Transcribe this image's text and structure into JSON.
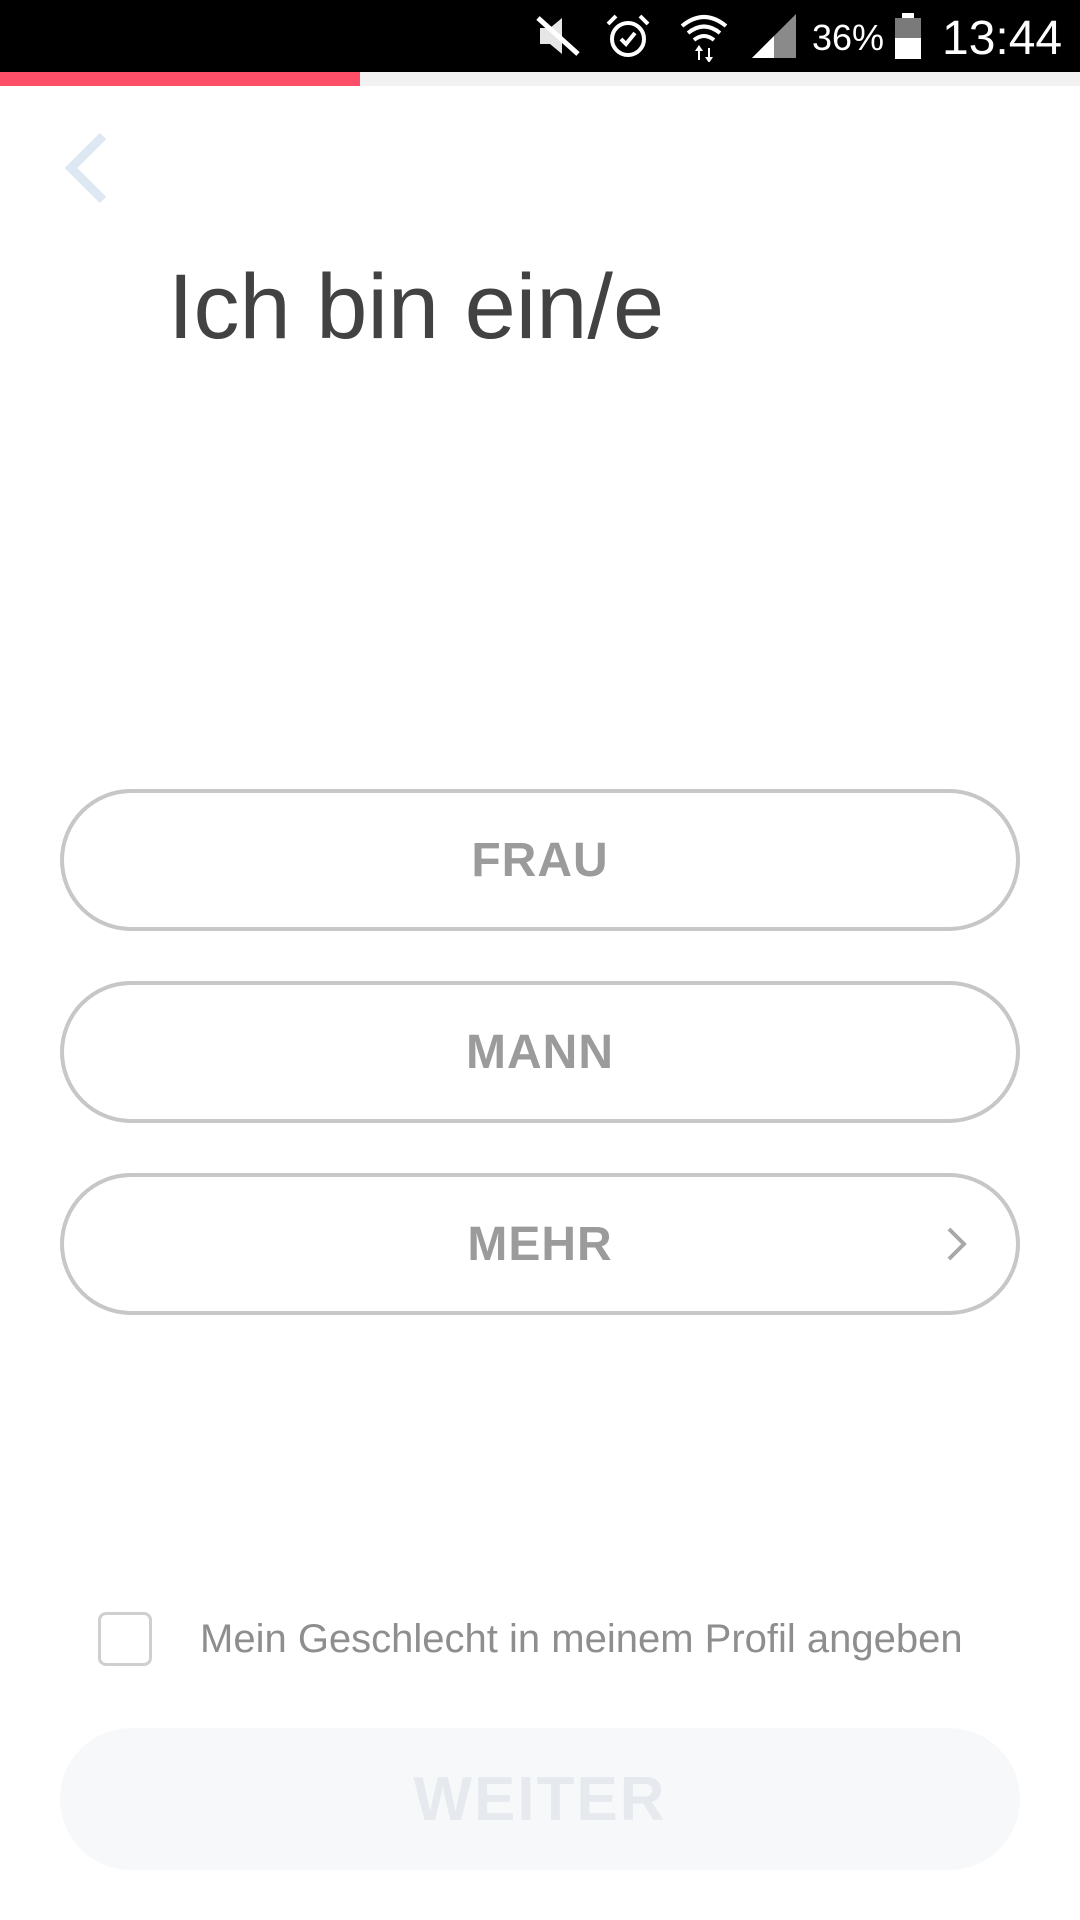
{
  "status_bar": {
    "battery_percent": "36%",
    "time": "13:44",
    "icons": [
      "mute-icon",
      "alarm-icon",
      "wifi-icon",
      "signal-icon",
      "battery-icon"
    ]
  },
  "progress": {
    "fraction": 0.333,
    "color": "#fd5068"
  },
  "header": {
    "back_icon": "chevron-left-icon",
    "title": "Ich bin ein/e"
  },
  "options": [
    {
      "label": "FRAU"
    },
    {
      "label": "MANN"
    },
    {
      "label": "MEHR",
      "icon": "chevron-right-icon"
    }
  ],
  "show_gender": {
    "label": "Mein Geschlecht in meinem Profil angeben",
    "checked": false
  },
  "continue_button": {
    "label": "WEITER",
    "enabled": false
  },
  "colors": {
    "accent": "#fd5068",
    "title": "#424242",
    "option_text": "#9b9b9b",
    "option_border": "#c7c7c7",
    "disabled_bg": "#f6f8fa",
    "disabled_text": "#e6eaef",
    "back_icon": "#dde8f2"
  }
}
